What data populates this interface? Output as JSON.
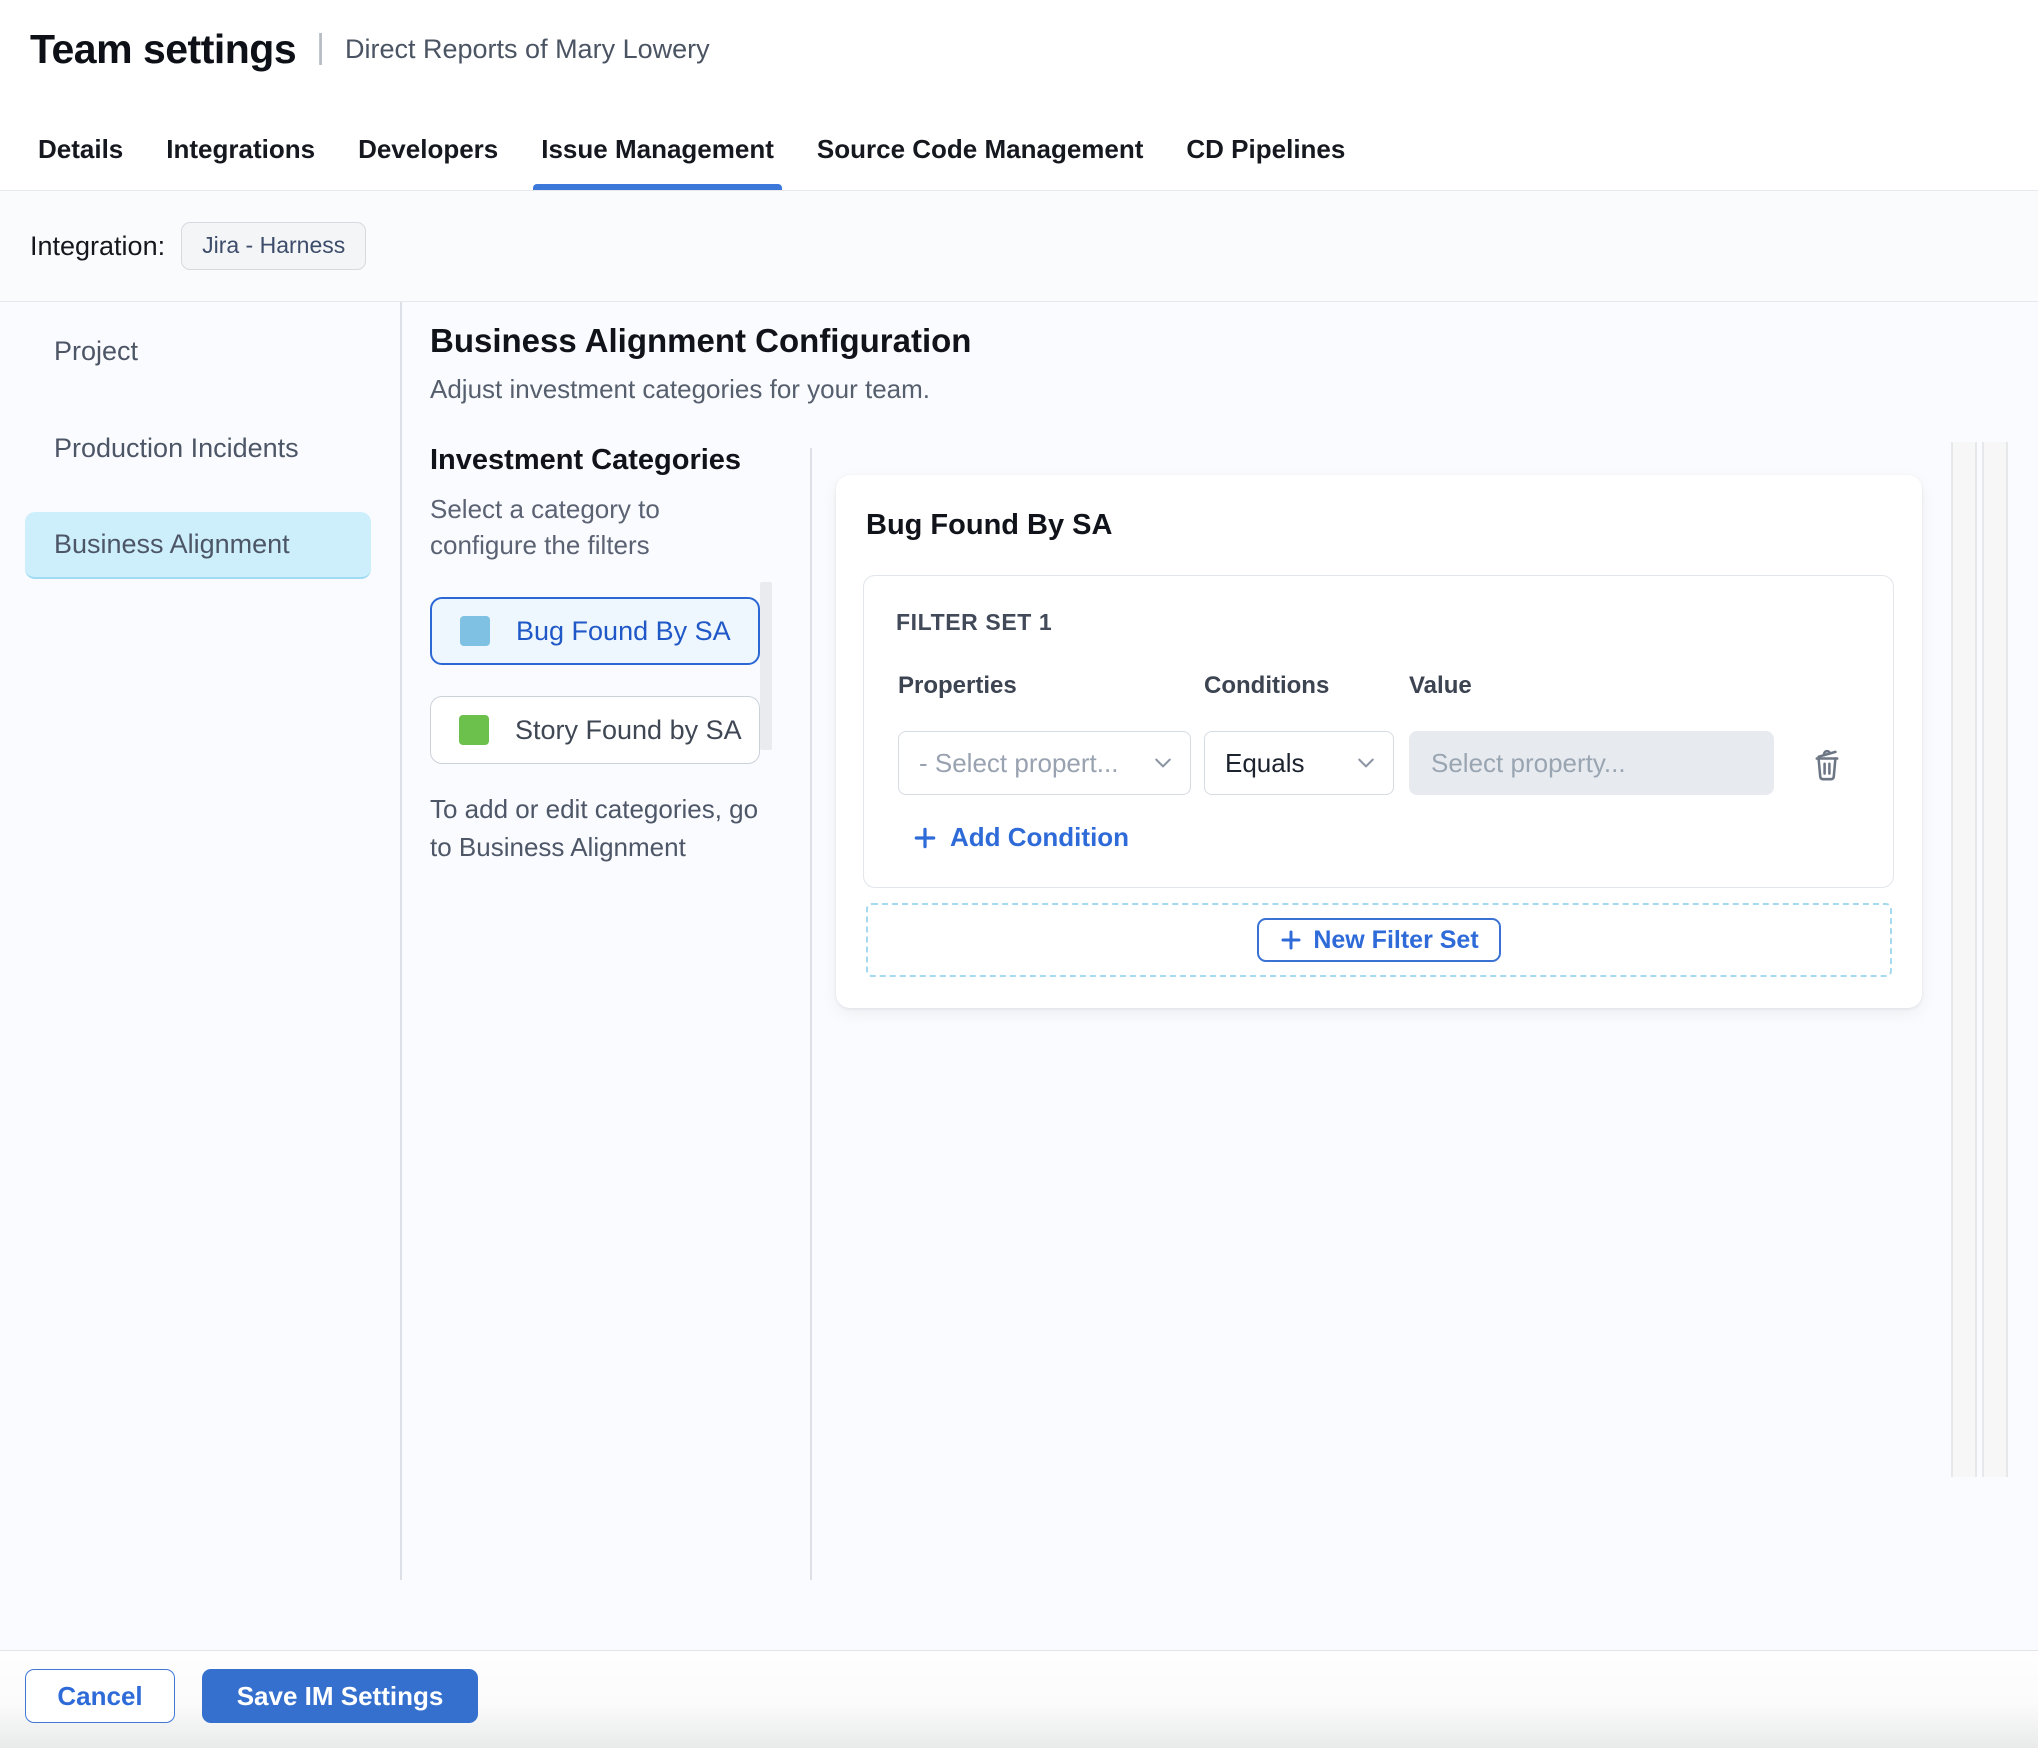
{
  "header": {
    "title": "Team settings",
    "separator": "|",
    "subtitle": "Direct Reports of Mary Lowery"
  },
  "tabs": {
    "items": [
      {
        "label": "Details",
        "active": false
      },
      {
        "label": "Integrations",
        "active": false
      },
      {
        "label": "Developers",
        "active": false
      },
      {
        "label": "Issue Management",
        "active": true
      },
      {
        "label": "Source Code Management",
        "active": false
      },
      {
        "label": "CD Pipelines",
        "active": false
      }
    ]
  },
  "integration": {
    "label": "Integration:",
    "chip": "Jira - Harness"
  },
  "sidebar": {
    "items": [
      {
        "label": "Project",
        "active": false
      },
      {
        "label": "Production Incidents",
        "active": false
      },
      {
        "label": "Business Alignment",
        "active": true
      }
    ]
  },
  "main": {
    "title": "Business Alignment Configuration",
    "subtitle": "Adjust investment categories for your team.",
    "categories": {
      "heading": "Investment Categories",
      "hint": "Select a category to configure the filters",
      "items": [
        {
          "label": "Bug Found By SA",
          "swatch_color": "#7fc1e3",
          "selected": true
        },
        {
          "label": "Story Found by SA",
          "swatch_color": "#6cc14d",
          "selected": false
        }
      ],
      "footnote": "To add or edit categories, go to Business Alignment"
    },
    "panel": {
      "title": "Bug Found By SA",
      "filter_set": {
        "label": "FILTER SET 1",
        "columns": [
          "Properties",
          "Conditions",
          "Value"
        ],
        "property_placeholder": "- Select propert...",
        "condition_value": "Equals",
        "value_placeholder": "Select property...",
        "add_condition_label": "Add Condition"
      },
      "new_filter_set_label": "New Filter Set"
    }
  },
  "footer": {
    "cancel_label": "Cancel",
    "save_label": "Save IM Settings"
  },
  "colors": {
    "accent_blue": "#2e6bd8",
    "tab_underline": "#3c78da",
    "save_button_bg": "#3570cf",
    "selected_category_bg": "#edf7fd",
    "selected_category_border": "#2c68d5",
    "sidebar_active_bg": "#cdeffb",
    "bug_swatch": "#7fc1e3",
    "story_swatch": "#6cc14d",
    "dashed_border": "#a5d9f0",
    "content_bg": "#fafbfe"
  }
}
